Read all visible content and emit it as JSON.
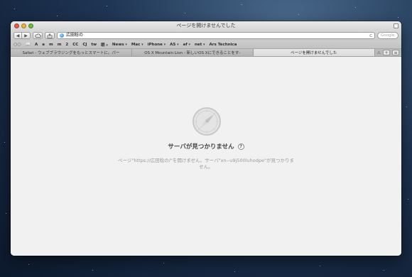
{
  "window": {
    "title": "ページを開けませんでした"
  },
  "toolbar": {
    "back_label": "◀",
    "forward_label": "▶",
    "url": "広田稔の",
    "reload_label": "c",
    "search_placeholder": "Google"
  },
  "bookmarks": {
    "items": [
      {
        "label": "A",
        "menu": false
      },
      {
        "label": "a",
        "menu": false
      },
      {
        "label": "m",
        "menu": false
      },
      {
        "label": "m",
        "menu": false
      },
      {
        "label": "2",
        "menu": false
      },
      {
        "label": "CC",
        "menu": false
      },
      {
        "label": "CJ",
        "menu": false
      },
      {
        "label": "tw",
        "menu": false
      },
      {
        "label": "眼",
        "menu": true
      },
      {
        "label": "News",
        "menu": true
      },
      {
        "label": "Mac",
        "menu": true
      },
      {
        "label": "iPhone",
        "menu": true
      },
      {
        "label": "AS",
        "menu": true
      },
      {
        "label": "af",
        "menu": true
      },
      {
        "label": "net",
        "menu": true
      },
      {
        "label": "Ars Technica",
        "menu": false
      }
    ]
  },
  "tabs": [
    {
      "label": "Safari - ウェブブラウジングをもっとスマートに。パー",
      "active": false
    },
    {
      "label": "OS X Mountain Lion - 新しいOS Xにできることをす-",
      "active": false
    },
    {
      "label": "ページを開けませんでした",
      "active": true
    }
  ],
  "error": {
    "title": "サーバが見つかりません",
    "help": "?",
    "message": "ページ\"https://広田稔の/\"を開けません。サーバ\"xn--u9j500luhodpe\"が見つかりません。"
  }
}
